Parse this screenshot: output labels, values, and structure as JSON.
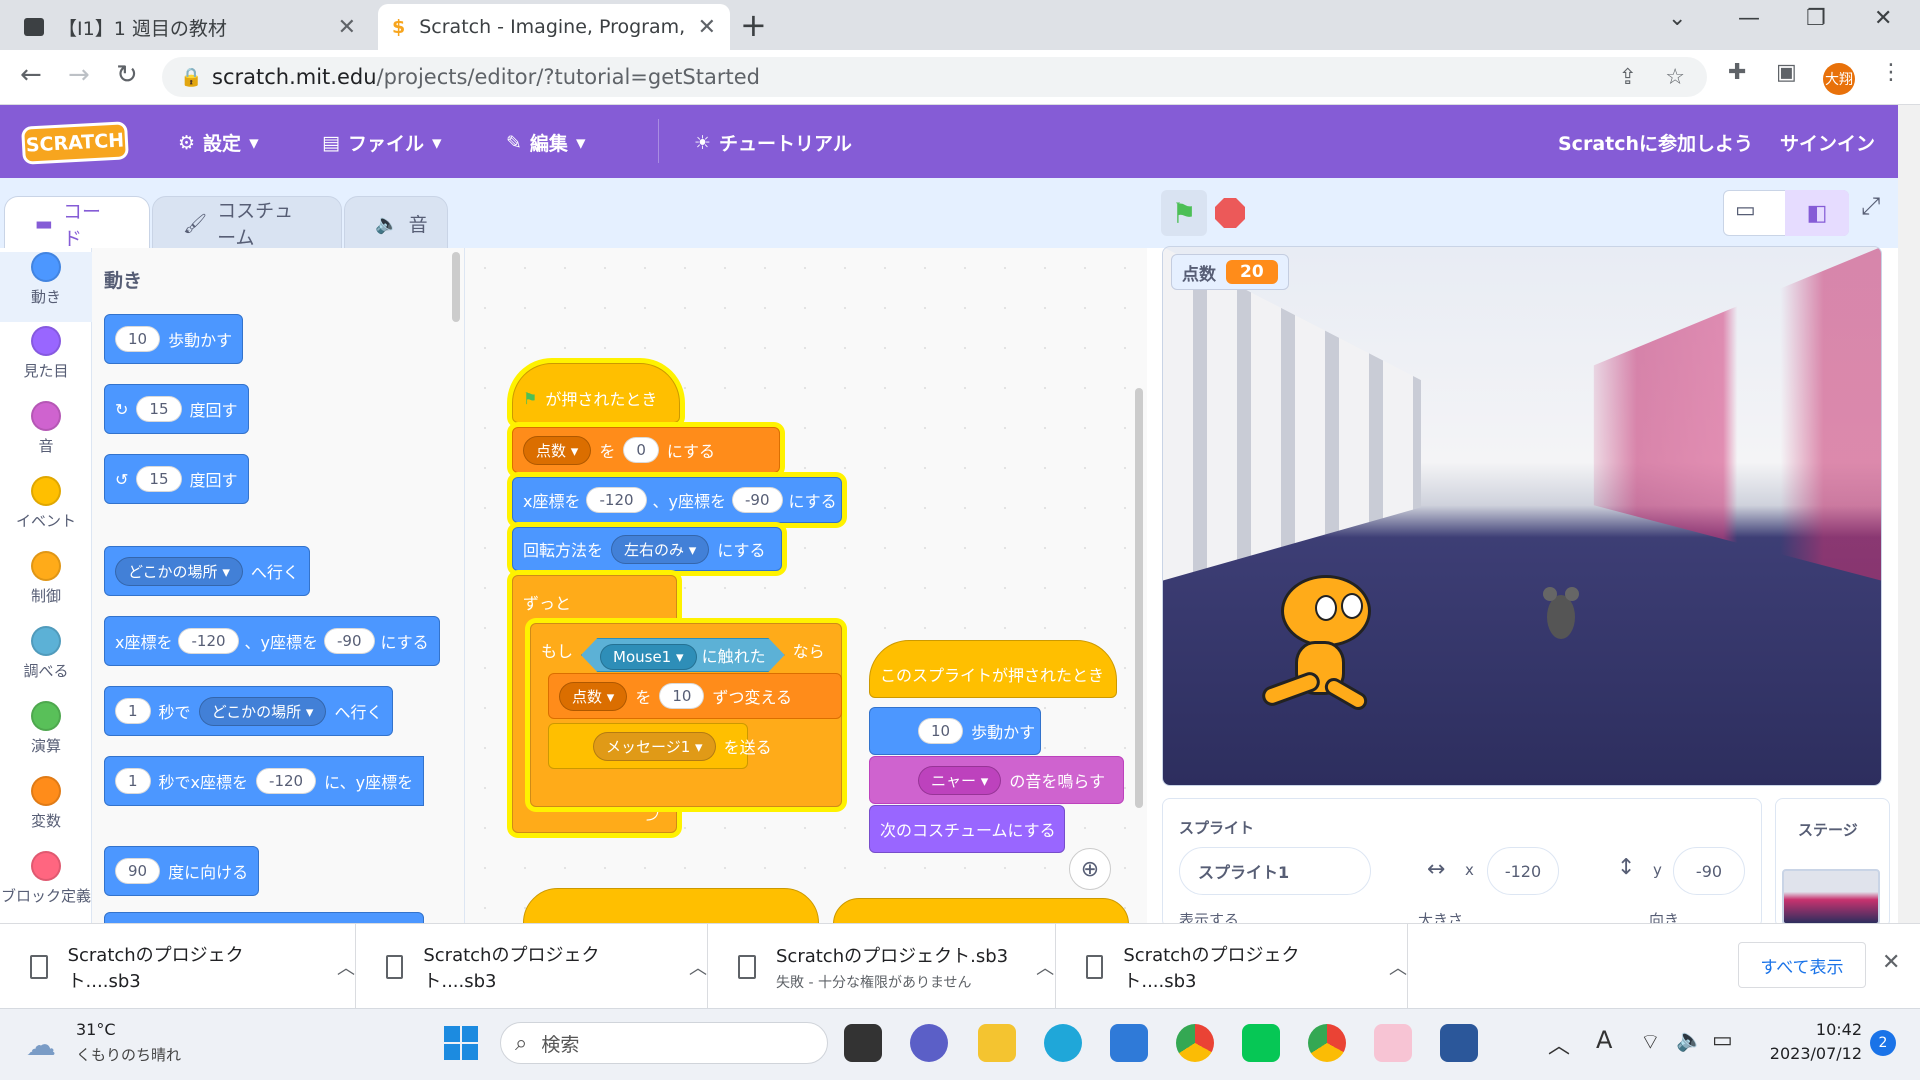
{
  "browser": {
    "tabs": [
      {
        "title": "【I1】1 週目の教材",
        "active": false
      },
      {
        "title": "Scratch - Imagine, Program, Shar",
        "active": true
      }
    ],
    "url_host": "scratch.mit.edu",
    "url_path": "/projects/editor/?tutorial=getStarted",
    "avatar_text": "大翔"
  },
  "menu": {
    "logo": "SCRATCH",
    "settings": "設定",
    "file": "ファイル",
    "edit": "編集",
    "tutorial": "チュートリアル",
    "join": "Scratchに参加しよう",
    "signin": "サインイン"
  },
  "editor_tabs": {
    "code": "コード",
    "costume": "コスチューム",
    "sound": "音"
  },
  "categories": [
    {
      "label": "動き",
      "color": "#4c97ff"
    },
    {
      "label": "見た目",
      "color": "#9966ff"
    },
    {
      "label": "音",
      "color": "#cf63cf"
    },
    {
      "label": "イベント",
      "color": "#ffbf00"
    },
    {
      "label": "制御",
      "color": "#ffab19"
    },
    {
      "label": "調べる",
      "color": "#5cb1d6"
    },
    {
      "label": "演算",
      "color": "#59c059"
    },
    {
      "label": "変数",
      "color": "#ff8c1a"
    },
    {
      "label": "ブロック定義",
      "color": "#ff6680"
    }
  ],
  "palette": {
    "heading": "動き",
    "move": {
      "value": "10",
      "text": "歩動かす"
    },
    "turn_right": {
      "value": "15",
      "text": "度回す"
    },
    "turn_left": {
      "value": "15",
      "text": "度回す"
    },
    "goto": {
      "dropdown": "どこかの場所",
      "text": "へ行く"
    },
    "gotoxy": {
      "t1": "x座標を",
      "x": "-120",
      "t2": "、y座標を",
      "y": "-90",
      "t3": "にする"
    },
    "glide": {
      "value": "1",
      "t1": "秒で",
      "dropdown": "どこかの場所",
      "t2": "へ行く"
    },
    "glidexy": {
      "value": "1",
      "t1": "秒でx座標を",
      "x": "-120",
      "t2": "に、y座標を"
    },
    "point": {
      "value": "90",
      "text": "度に向ける"
    }
  },
  "script1": {
    "hat": "が押されたとき",
    "setvar": {
      "var": "点数",
      "t1": "を",
      "value": "0",
      "t2": "にする"
    },
    "gotoxy": {
      "t1": "x座標を",
      "x": "-120",
      "t2": "、y座標を",
      "y": "-90",
      "t3": "にする"
    },
    "rotation": {
      "t1": "回転方法を",
      "dropdown": "左右のみ",
      "t2": "にする"
    },
    "forever": "ずっと",
    "if": {
      "t1": "もし",
      "sprite": "Mouse1",
      "t2": "に触れた",
      "t3": "なら"
    },
    "changevar": {
      "var": "点数",
      "t1": "を",
      "value": "10",
      "t2": "ずつ変える"
    },
    "broadcast": {
      "msg": "メッセージ1",
      "text": "を送る"
    }
  },
  "script2": {
    "hat": "このスプライトが押されたとき",
    "move": {
      "value": "10",
      "text": "歩動かす"
    },
    "sound": {
      "dropdown": "ニャー",
      "text": "の音を鳴らす"
    },
    "costume": "次のコスチュームにする"
  },
  "stage": {
    "score_label": "点数",
    "score_value": "20"
  },
  "sprite_info": {
    "label": "スプライト",
    "name": "スプライト1",
    "x_label": "x",
    "x": "-120",
    "y_label": "y",
    "y": "-90",
    "show_label": "表示する",
    "size_label": "大きさ",
    "direction_label": "向き",
    "stage_label": "ステージ"
  },
  "downloads": [
    {
      "name": "Scratchのプロジェクト....sb3",
      "sub": ""
    },
    {
      "name": "Scratchのプロジェクト....sb3",
      "sub": ""
    },
    {
      "name": "Scratchのプロジェクト.sb3",
      "sub": "失敗 - 十分な権限がありません"
    },
    {
      "name": "Scratchのプロジェクト....sb3",
      "sub": ""
    }
  ],
  "downloads_show_all": "すべて表示",
  "taskbar": {
    "temp": "31°C",
    "weather": "くもりのち晴れ",
    "search": "検索",
    "time": "10:42",
    "date": "2023/07/12",
    "notifications": "2",
    "ime": "A"
  }
}
